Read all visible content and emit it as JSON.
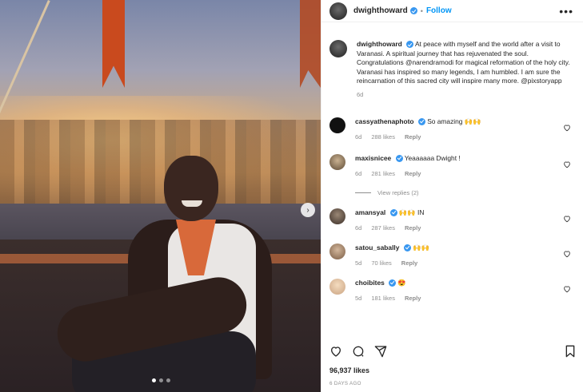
{
  "post": {
    "username": "dwighthoward",
    "follow_label": "Follow",
    "more_label": "•••",
    "caption": "At peace with myself and the world after a visit to Varanasi. A spiritual journey that has rejuvenated the soul. Congratulations @narendramodi for magical reformation of the holy city. Varanasi has inspired so many legends, I am humbled. I am sure the reincarnation of this sacred city will inspire many more. @pixstoryapp",
    "caption_time": "6d",
    "likes": "96,937 likes",
    "date": "6 DAYS AGO"
  },
  "comments": [
    {
      "username": "cassyathenaphoto",
      "verified": true,
      "text": "So amazing 🙌🙌",
      "time": "6d",
      "likes": "288 likes",
      "reply": "Reply"
    },
    {
      "username": "maxisnicee",
      "verified": true,
      "text": "Yeaaaaaa Dwight !",
      "time": "6d",
      "likes": "281 likes",
      "reply": "Reply"
    },
    {
      "username": "amansyal",
      "verified": true,
      "text": "🙌🙌 IN",
      "time": "6d",
      "likes": "287 likes",
      "reply": "Reply"
    },
    {
      "username": "satou_sabally",
      "verified": true,
      "text": "🙌🙌",
      "time": "5d",
      "likes": "70 likes",
      "reply": "Reply"
    },
    {
      "username": "choibites",
      "verified": true,
      "text": "😍",
      "time": "5d",
      "likes": "181 likes",
      "reply": "Reply"
    }
  ],
  "view_replies": "View replies (2)",
  "icons": {
    "like": "heart-icon",
    "comment": "comment-icon",
    "share": "share-icon",
    "save": "bookmark-icon",
    "carousel_next": "chevron-right-icon"
  },
  "colors": {
    "accent": "#0095f6",
    "verified": "#3897f0",
    "muted": "#8e8e8e"
  }
}
